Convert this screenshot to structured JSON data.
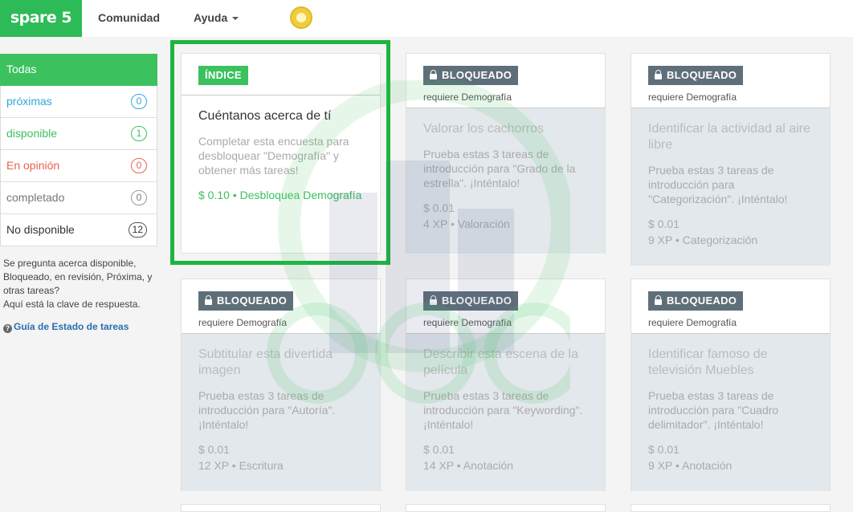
{
  "app": {
    "logo": "spare 5"
  },
  "nav": [
    {
      "label": "Comunidad"
    },
    {
      "label": "Ayuda"
    }
  ],
  "sidebar": {
    "items": [
      {
        "label": "Todas",
        "count": null,
        "color": "#ffffff"
      },
      {
        "label": "próximas",
        "count": "0",
        "color": "#2eaad9"
      },
      {
        "label": "disponible",
        "count": "1",
        "color": "#3cc15f"
      },
      {
        "label": "En opinión",
        "count": "0",
        "color": "#e9614f"
      },
      {
        "label": "completado",
        "count": "0",
        "color": "#777777"
      },
      {
        "label": "No disponible",
        "count": "12",
        "color": "#333333"
      }
    ],
    "help_text": "Se pregunta acerca disponible, Bloqueado, en revisión, Próxima, y otras tareas?",
    "help_text2": "Aquí está la clave de respuesta.",
    "guide_link": "Guía de Estado de tareas"
  },
  "cards": [
    {
      "tag": "ÍNDICE",
      "requirement": "",
      "title": "Cuéntanos acerca de tí",
      "description": "Completar esta encuesta para desbloquear \"Demografía\" y obtener más tareas!",
      "price": "$ 0.10 • Desbloquea Demografía",
      "xp": ""
    },
    {
      "tag": "BLOQUEADO",
      "requirement": "requiere Demografía",
      "title": "Valorar los cachorros",
      "description": "Prueba estas 3 tareas de introducción para \"Grado de la estrella\". ¡Inténtalo!",
      "price": "$ 0.01",
      "xp": "4 XP • Valoración"
    },
    {
      "tag": "BLOQUEADO",
      "requirement": "requiere Demografía",
      "title": "Identificar la actividad al aire libre",
      "description": "Prueba estas 3 tareas de introducción para \"Categorización\". ¡Inténtalo!",
      "price": "$ 0.01",
      "xp": "9 XP • Categorización"
    },
    {
      "tag": "BLOQUEADO",
      "requirement": "requiere Demografía",
      "title": "Subtitular esta divertida imagen",
      "description": "Prueba estas 3 tareas de introducción para \"Autoría\". ¡Inténtalo!",
      "price": "$ 0.01",
      "xp": "12 XP • Escritura"
    },
    {
      "tag": "BLOQUEADO",
      "requirement": "requiere Demografía",
      "title": "Describir esta escena de la película",
      "description": "Prueba estas 3 tareas de introducción para \"Keywording\". ¡Inténtalo!",
      "price": "$ 0.01",
      "xp": "14 XP • Anotación"
    },
    {
      "tag": "BLOQUEADO",
      "requirement": "requiere Demografía",
      "title": "Identificar famoso de televisión Muebles",
      "description": "Prueba estas 3 tareas de introducción para \"Cuadro delimitador\". ¡Inténtalo!",
      "price": "$ 0.01",
      "xp": "9 XP • Anotación"
    }
  ],
  "colors": {
    "brand": "#2dbb57",
    "highlight": "#1db53f",
    "locked_tag": "#5f6f79"
  }
}
